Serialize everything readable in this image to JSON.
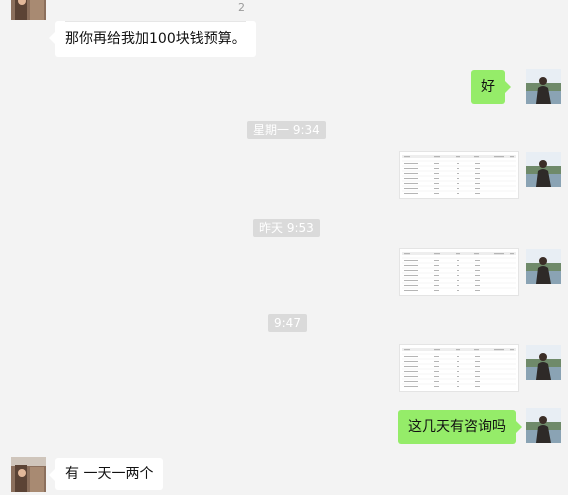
{
  "top_badge": "2",
  "messages": {
    "m1": "那你再给我加100块钱预算。",
    "m2": "好",
    "m3": "这几天有咨询吗",
    "m4": "有 一天一两个"
  },
  "timestamps": {
    "t1": "星期一 9:34",
    "t2": "昨天 9:53",
    "t3": "9:47"
  },
  "colors": {
    "background": "#f3f3f3",
    "outgoing_bubble": "#95ec69",
    "incoming_bubble": "#ffffff",
    "timestamp_bg": "#dadada"
  },
  "icons": {
    "self_avatar": "avatar-landscape-person",
    "contact_avatar": "avatar-photo"
  }
}
